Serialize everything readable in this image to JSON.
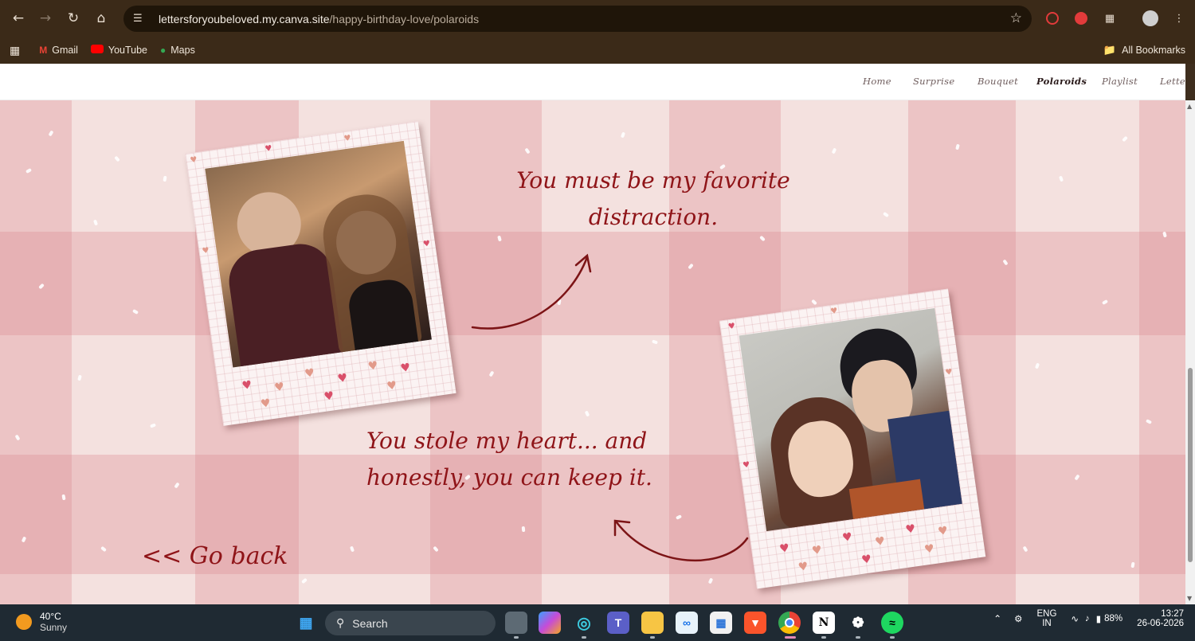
{
  "browser": {
    "url_host": "lettersforyoubeloved.my.canva.site",
    "url_path": "/happy-birthday-love/polaroids",
    "bookmarks": [
      {
        "label": "Gmail",
        "icon": "gmail-icon"
      },
      {
        "label": "YouTube",
        "icon": "youtube-icon"
      },
      {
        "label": "Maps",
        "icon": "maps-icon"
      }
    ],
    "all_bookmarks_label": "All Bookmarks"
  },
  "site_nav": {
    "items": [
      "Home",
      "Surprise",
      "Bouquet",
      "Polaroids",
      "Playlist",
      "Letter"
    ],
    "active": "Polaroids"
  },
  "content": {
    "caption_1_line_1": "You must be my favorite",
    "caption_1_line_2": "distraction.",
    "caption_2_line_1": "You stole my heart... and",
    "caption_2_line_2": "honestly, you can keep it.",
    "go_back": "<< Go back"
  },
  "colors": {
    "accent_text": "#8f1418",
    "background": "#f4e1df",
    "gingham": "#de8e94"
  },
  "taskbar": {
    "temperature": "40°C",
    "weather": "Sunny",
    "search_placeholder": "Search",
    "language_1": "ENG",
    "language_2": "IN",
    "battery": "88%",
    "time": "13:27",
    "date": "26-06-2026"
  }
}
